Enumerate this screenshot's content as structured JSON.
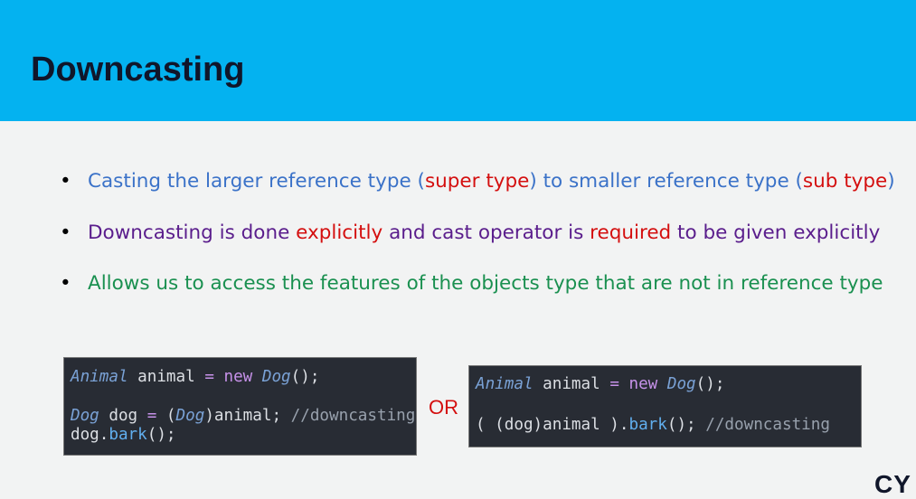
{
  "slide": {
    "title": "Downcasting",
    "bullets": [
      {
        "parts": [
          "Casting the larger reference type (",
          "super type",
          ") to smaller reference type (",
          "sub type",
          ")"
        ]
      },
      {
        "parts": [
          "Downcasting is done ",
          "explicitly",
          " and cast operator is ",
          "required",
          " to be given explicitly"
        ]
      },
      {
        "parts": [
          "Allows us to access the features of the objects type that are not in reference type"
        ]
      }
    ],
    "bullet_glyph": "•",
    "or_label": "OR",
    "logo_text": "CY"
  },
  "code_left": {
    "line1": {
      "type": "Animal",
      "var": " animal ",
      "op": "=",
      "kw": " new ",
      "ctor": "Dog",
      "end": "();"
    },
    "line2": {
      "type": "Dog",
      "var": " dog ",
      "op": "=",
      "paren": " (",
      "cast": "Dog",
      "rest": ")animal; ",
      "comment": "//downcasting"
    },
    "line3": {
      "obj": "dog.",
      "fn": "bark",
      "end": "();"
    }
  },
  "code_right": {
    "line1": {
      "type": "Animal",
      "var": " animal ",
      "op": "=",
      "kw": " new ",
      "ctor": "Dog",
      "end": "();"
    },
    "line2": {
      "pre": "( (dog)animal ).",
      "fn": "bark",
      "end": "(); ",
      "comment": "//downcasting"
    }
  },
  "colors": {
    "header": "#04b2f0",
    "blue_text": "#3b72c8",
    "red_text": "#d40f0f",
    "purple_text": "#5a1d8c",
    "green_text": "#1a9050",
    "code_bg": "#282c34"
  }
}
